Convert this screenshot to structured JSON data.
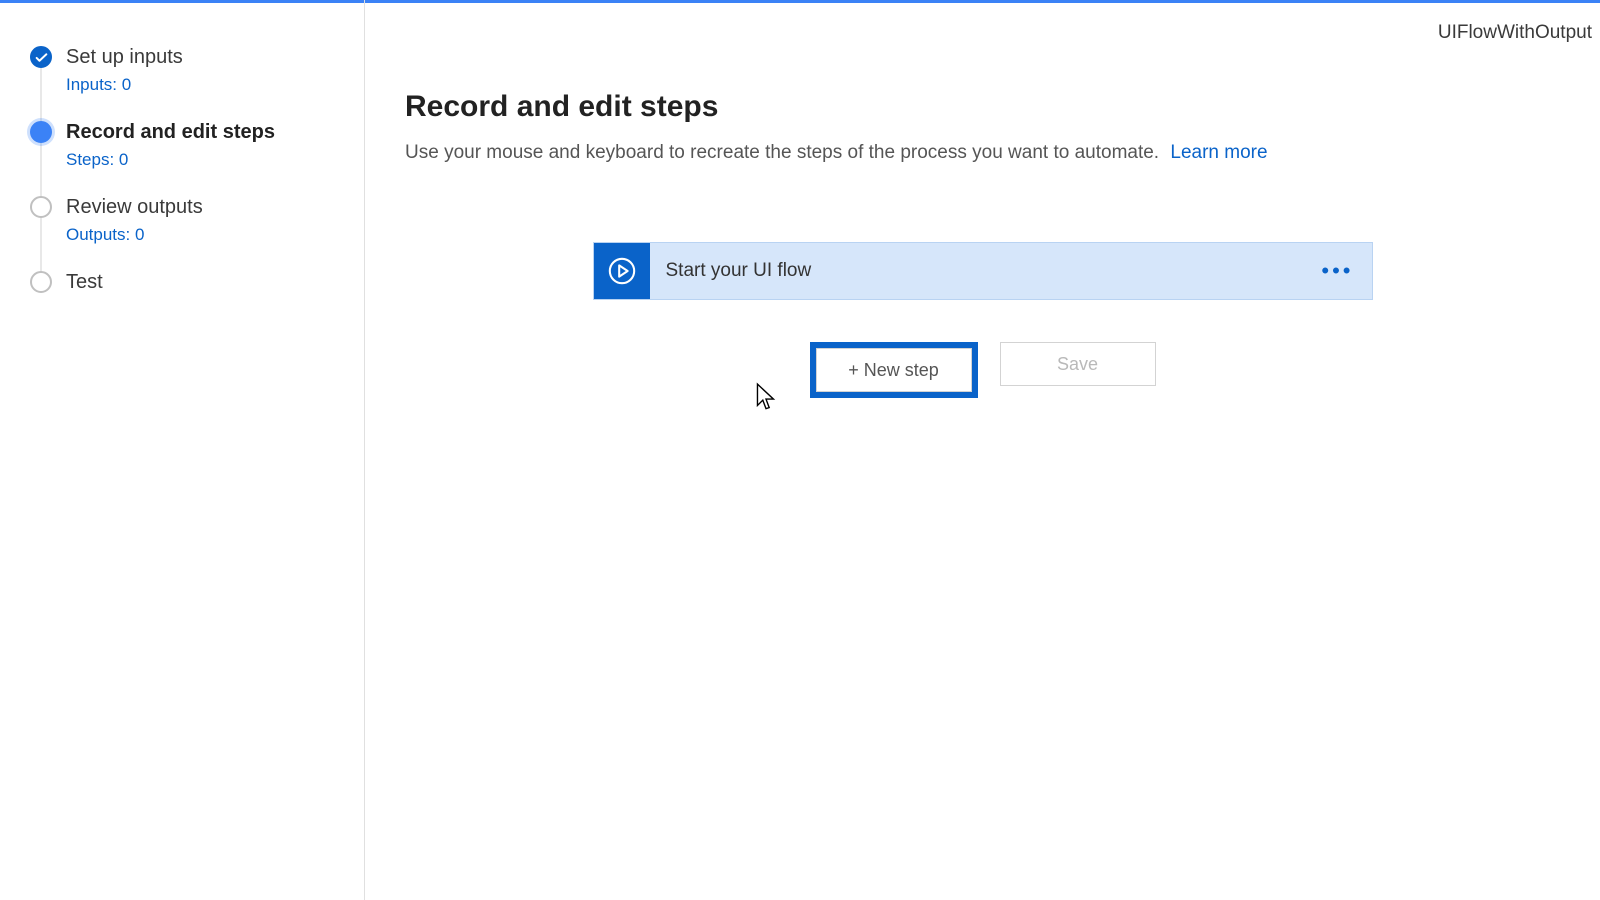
{
  "flow_name": "UIFlowWithOutput",
  "sidebar": {
    "steps": [
      {
        "title": "Set up inputs",
        "sub": "Inputs: 0",
        "state": "done"
      },
      {
        "title": "Record and edit steps",
        "sub": "Steps: 0",
        "state": "current"
      },
      {
        "title": "Review outputs",
        "sub": "Outputs: 0",
        "state": "pending"
      },
      {
        "title": "Test",
        "sub": "",
        "state": "pending"
      }
    ]
  },
  "main": {
    "title": "Record and edit steps",
    "description": "Use your mouse and keyboard to recreate the steps of the process you want to automate.",
    "learn_more": "Learn more",
    "card_title": "Start your UI flow",
    "new_step_label": "+ New step",
    "save_label": "Save"
  }
}
